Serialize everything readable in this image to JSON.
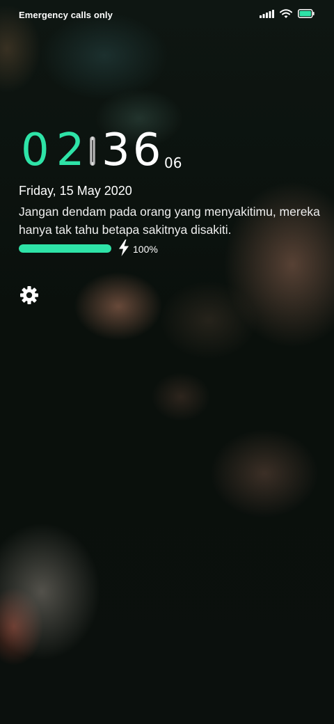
{
  "status_bar": {
    "carrier_text": "Emergency calls only",
    "signal_icon": "signal-bars-icon",
    "wifi_icon": "wifi-icon",
    "battery_icon": "battery-icon",
    "battery_level": 1.0
  },
  "clock": {
    "hours": "02",
    "minutes": "36",
    "seconds": "06",
    "hours_color": "#2ee3a7"
  },
  "date_text": "Friday, 15 May 2020",
  "quote_text": "Jangan dendam pada orang yang menyakitimu, mereka hanya tak tahu betapa sakitnya disakiti.",
  "battery": {
    "percent_text": "100%",
    "level": 1.0,
    "charging_icon": "lightning-bolt-icon",
    "bar_color": "#2ee3a7"
  },
  "settings": {
    "icon": "gear-icon"
  }
}
